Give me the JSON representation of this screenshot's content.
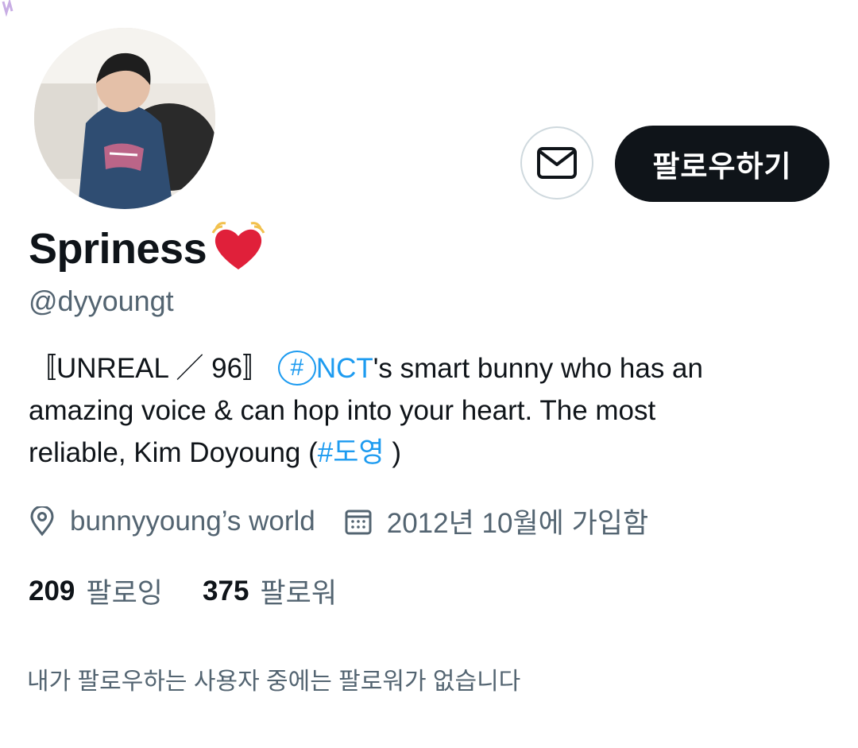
{
  "profile": {
    "display_name": "Spriness",
    "handle": "@dyyoungt",
    "avatar_icon": "profile-photo"
  },
  "actions": {
    "message_icon": "envelope-icon",
    "follow_label": "팔로우하기"
  },
  "bio": {
    "line1_prefix": "〚UNREAL ／ 96〛",
    "line1_hashtag": "NCT",
    "line1_suffix": "'s smart bunny who has an",
    "line2": "amazing voice & can hop into your heart. The most",
    "line3_prefix": "reliable, Kim Doyoung (",
    "line3_hashtag": "도영",
    "line3_suffix": " )",
    "hash_symbol": "#"
  },
  "meta": {
    "location": "bunnyyoung’s world",
    "joined": "2012년 10월에 가입함"
  },
  "stats": {
    "following_count": "209",
    "following_label": "팔로잉",
    "followers_count": "375",
    "followers_label": "팔로워"
  },
  "note": "내가 팔로우하는 사용자 중에는 팔로워가 없습니다",
  "colors": {
    "accent": "#1d9bf0",
    "text": "#0f1419",
    "secondary": "#536471",
    "button_bg": "#0f1419"
  }
}
